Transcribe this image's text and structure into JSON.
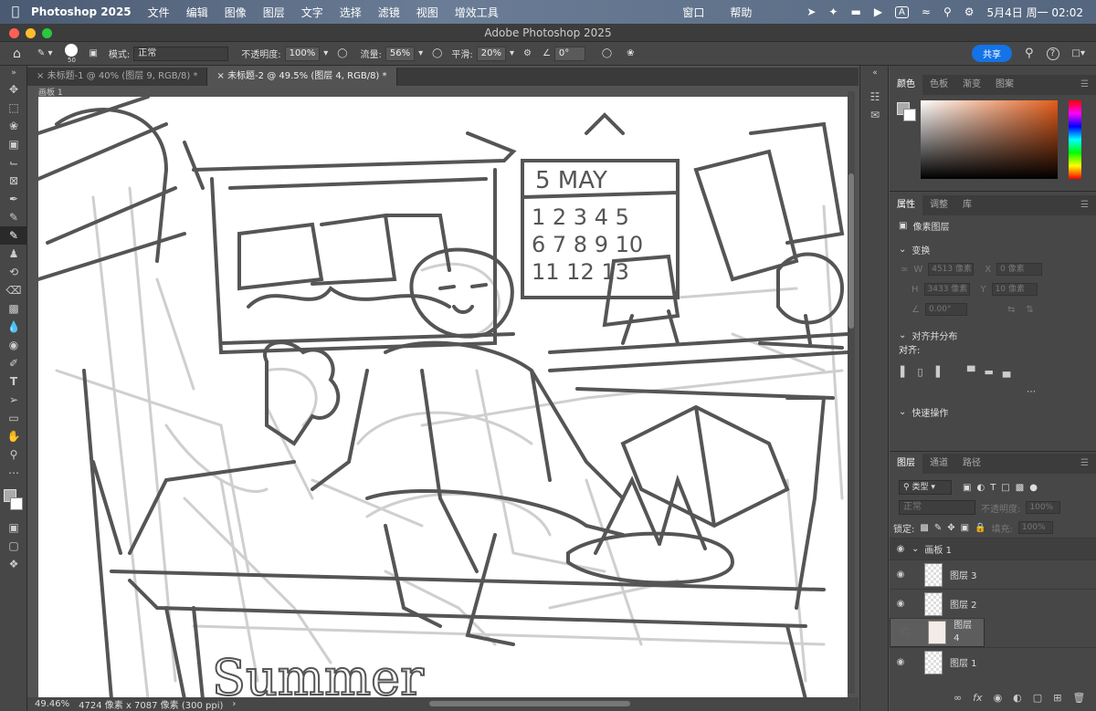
{
  "menubar": {
    "app": "Photoshop 2025",
    "items": [
      "文件",
      "编辑",
      "图像",
      "图层",
      "文字",
      "选择",
      "滤镜",
      "视图",
      "增效工具"
    ],
    "right_items": [
      "窗口",
      "帮助"
    ],
    "datetime": "5月4日 周一  02:02",
    "input_badge": "A"
  },
  "window": {
    "title": "Adobe Photoshop 2025"
  },
  "options": {
    "brush_size": "50",
    "mode_label": "模式:",
    "mode_value": "正常",
    "opacity_label": "不透明度:",
    "opacity_value": "100%",
    "flow_label": "流量:",
    "flow_value": "56%",
    "smooth_label": "平滑:",
    "smooth_value": "20%",
    "angle_value": "0°",
    "share_label": "共享"
  },
  "tabs": [
    {
      "label": "未标题-1 @ 40% (图层 9, RGB/8) *",
      "active": false
    },
    {
      "label": "未标题-2 @ 49.5% (图层 4, RGB/8) *",
      "active": true
    }
  ],
  "canvas": {
    "artboard_label": "画板 1",
    "calendar_month": "5 MAY",
    "calendar_row1": "1 2 3 4 5",
    "calendar_row2": "6 7 8 9 10",
    "calendar_row3": "11 12 13",
    "sketch_text": "Summer"
  },
  "status": {
    "zoom": "49.46%",
    "doc_info": "4724 像素 x 7087 像素 (300 ppi)"
  },
  "color_panel": {
    "tabs": [
      "颜色",
      "色板",
      "渐变",
      "图案"
    ],
    "active": "颜色"
  },
  "properties_panel": {
    "tabs": [
      "属性",
      "调整",
      "库"
    ],
    "layer_type": "像素图层",
    "transform_label": "变换",
    "w_label": "W",
    "w_value": "4513 像素",
    "x_label": "X",
    "x_value": "0 像素",
    "h_label": "H",
    "h_value": "3433 像素",
    "y_label": "Y",
    "y_value": "10 像素",
    "angle_value": "0.00°",
    "align_label": "对齐并分布",
    "align_sub": "对齐:",
    "quick_actions": "快速操作"
  },
  "layers_panel": {
    "tabs": [
      "图层",
      "通道",
      "路径"
    ],
    "filter_kind": "类型",
    "blend_mode": "正常",
    "opacity_label": "不透明度:",
    "opacity_value": "100%",
    "lock_label": "锁定:",
    "fill_label": "填充:",
    "fill_value": "100%",
    "group_name": "画板 1",
    "layers": [
      {
        "name": "图层 3",
        "visible": true,
        "selected": false
      },
      {
        "name": "图层 2",
        "visible": true,
        "selected": false
      },
      {
        "name": "图层 4",
        "visible": false,
        "selected": true
      },
      {
        "name": "图层 1",
        "visible": true,
        "selected": false
      }
    ]
  }
}
